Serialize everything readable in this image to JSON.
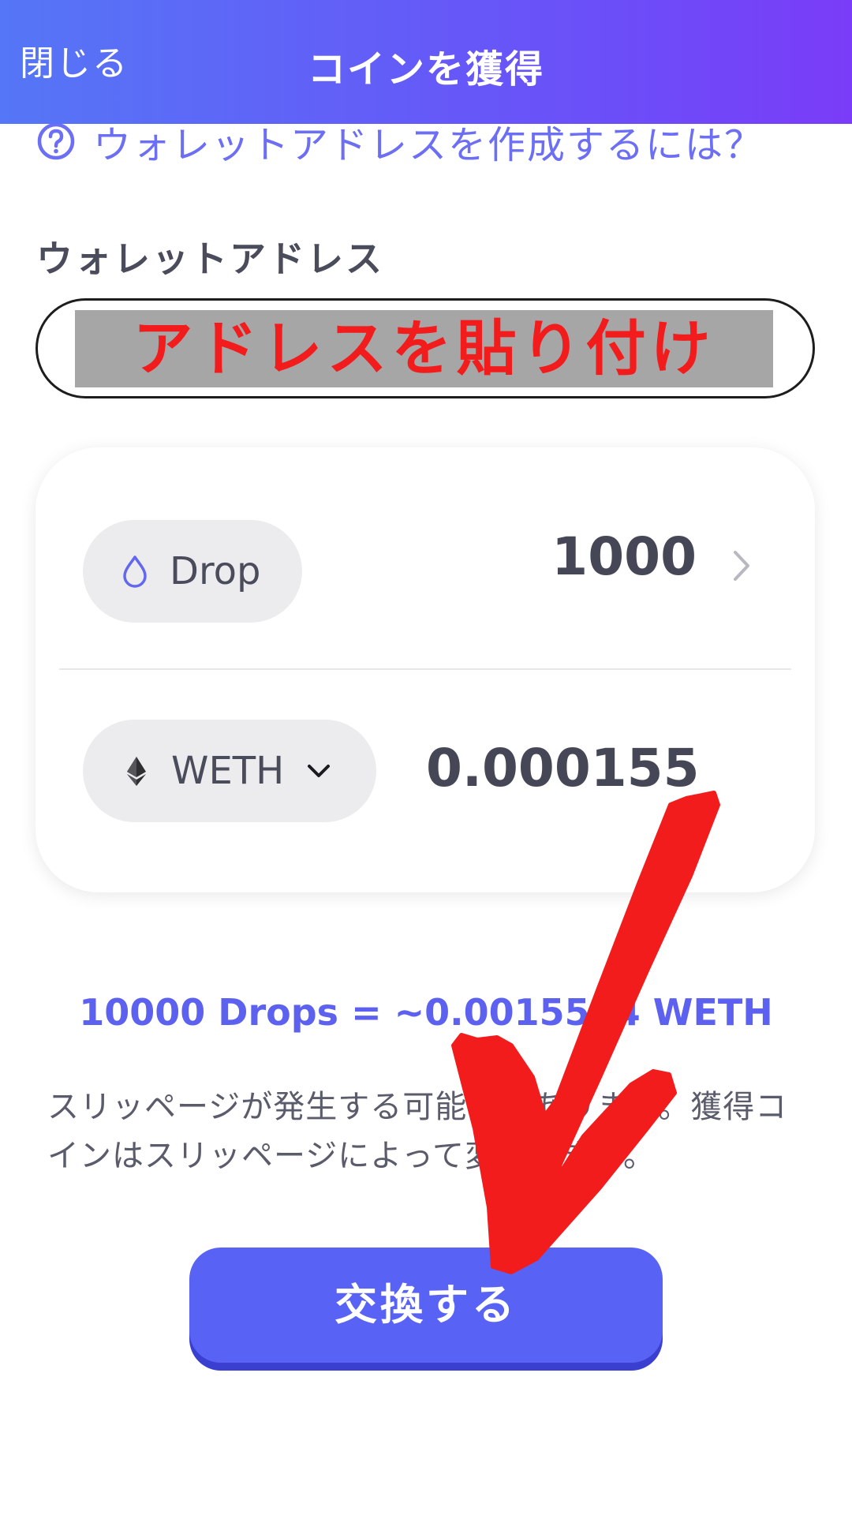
{
  "header": {
    "close_label": "閉じる",
    "title": "コインを獲得"
  },
  "help": {
    "link_label": "ウォレットアドレスを作成するには？"
  },
  "wallet": {
    "label": "ウォレットアドレス",
    "overlay_text": "アドレスを貼り付け"
  },
  "exchange": {
    "from_token": "Drop",
    "from_amount": "1000",
    "to_token": "WETH",
    "to_amount": "0.000155"
  },
  "rate_text": "10000 Drops = ~0.0015514 WETH",
  "slippage_note": "スリッページが発生する可能性があります。獲得コインはスリッページによって変動します。",
  "action": {
    "exchange_label": "交換する"
  },
  "colors": {
    "header_start": "#5576f6",
    "header_end": "#7a3cf8",
    "accent": "#5863f6",
    "annotation_red": "#f21c1c"
  },
  "icons": {
    "help": "question-circle-icon",
    "drop": "drop-icon",
    "weth": "ethereum-icon",
    "dropdown": "chevron-down-icon",
    "forward": "chevron-right-icon"
  }
}
